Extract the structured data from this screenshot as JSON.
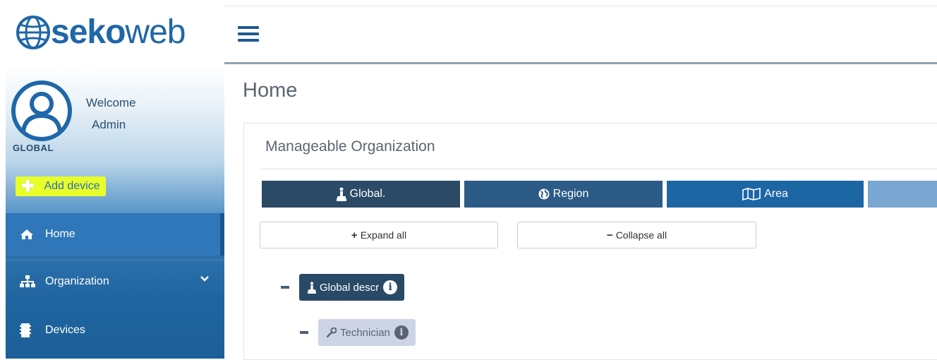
{
  "brand": {
    "bold": "seko",
    "light": "web"
  },
  "user": {
    "welcome": "Welcome",
    "name": "Admin",
    "scope": "GLOBAL"
  },
  "actions": {
    "add_device": "Add device"
  },
  "sidebar": {
    "items": [
      {
        "label": "Home",
        "icon": "home-icon",
        "active": true
      },
      {
        "label": "Organization",
        "icon": "sitemap-icon",
        "has_submenu": true
      },
      {
        "label": "Devices",
        "icon": "chip-icon"
      }
    ]
  },
  "page": {
    "title": "Home"
  },
  "panel": {
    "title": "Manageable Organization",
    "levels": [
      {
        "label": "Global.",
        "icon": "global-level-icon",
        "color": "#2a4a66"
      },
      {
        "label": "Region",
        "icon": "globe-icon",
        "color": "#2c5b88"
      },
      {
        "label": "Area",
        "icon": "map-icon",
        "color": "#1d66a4"
      },
      {
        "label": "",
        "icon": "",
        "color": "#7aa6d2"
      }
    ],
    "expand_all": "Expand all",
    "collapse_all": "Collapse all",
    "tree": [
      {
        "label": "Global descr",
        "icon": "global-level-icon",
        "level": 0
      },
      {
        "label": "Technician",
        "icon": "wrench-icon",
        "level": 1
      }
    ]
  },
  "colors": {
    "accent": "#1f67a8",
    "highlight": "#e8ff2a",
    "sidebar_active": "#2f77b8"
  }
}
